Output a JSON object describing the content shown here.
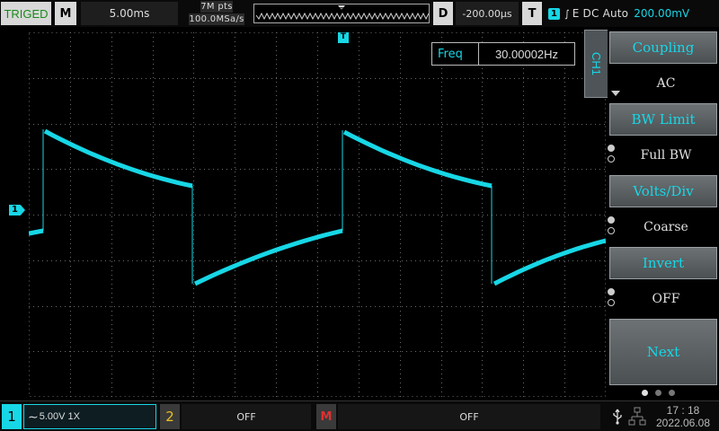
{
  "top_bar": {
    "trigger_status": "TRIGED",
    "mode_key": "M",
    "timebase": "5.00ms",
    "memory_depth": "7M pts",
    "sample_rate": "100.0MSa/s",
    "delay_key": "D",
    "horizontal_position": "-200.00µs",
    "trigger_key": "T",
    "trigger": {
      "channel": "1",
      "settings": "E DC Auto",
      "level": "200.00mV"
    }
  },
  "measurement": {
    "label": "Freq",
    "value": "30.00002Hz"
  },
  "markers": {
    "channel_marker": "1",
    "trigger_position_marker": "T"
  },
  "side_menu": {
    "channel_tab": "CH1",
    "items": [
      {
        "title": "Coupling",
        "value": "AC"
      },
      {
        "title": "BW Limit",
        "value": "Full BW"
      },
      {
        "title": "Volts/Div",
        "value": "Coarse"
      },
      {
        "title": "Invert",
        "value": "OFF"
      }
    ],
    "next_label": "Next"
  },
  "bottom_bar": {
    "ch1": {
      "key": "1",
      "settings": "5.00V 1X"
    },
    "ch2": {
      "key": "2",
      "state": "OFF"
    },
    "math": {
      "key": "M",
      "state": "OFF"
    },
    "time": "17 : 18",
    "date": "2022.06.08"
  },
  "colors": {
    "ch1": "#17d7e6",
    "ch2": "#e8c020",
    "math": "#e03030",
    "grid": "#6a6a6a",
    "trig_status_text": "#1a8a1a"
  }
}
